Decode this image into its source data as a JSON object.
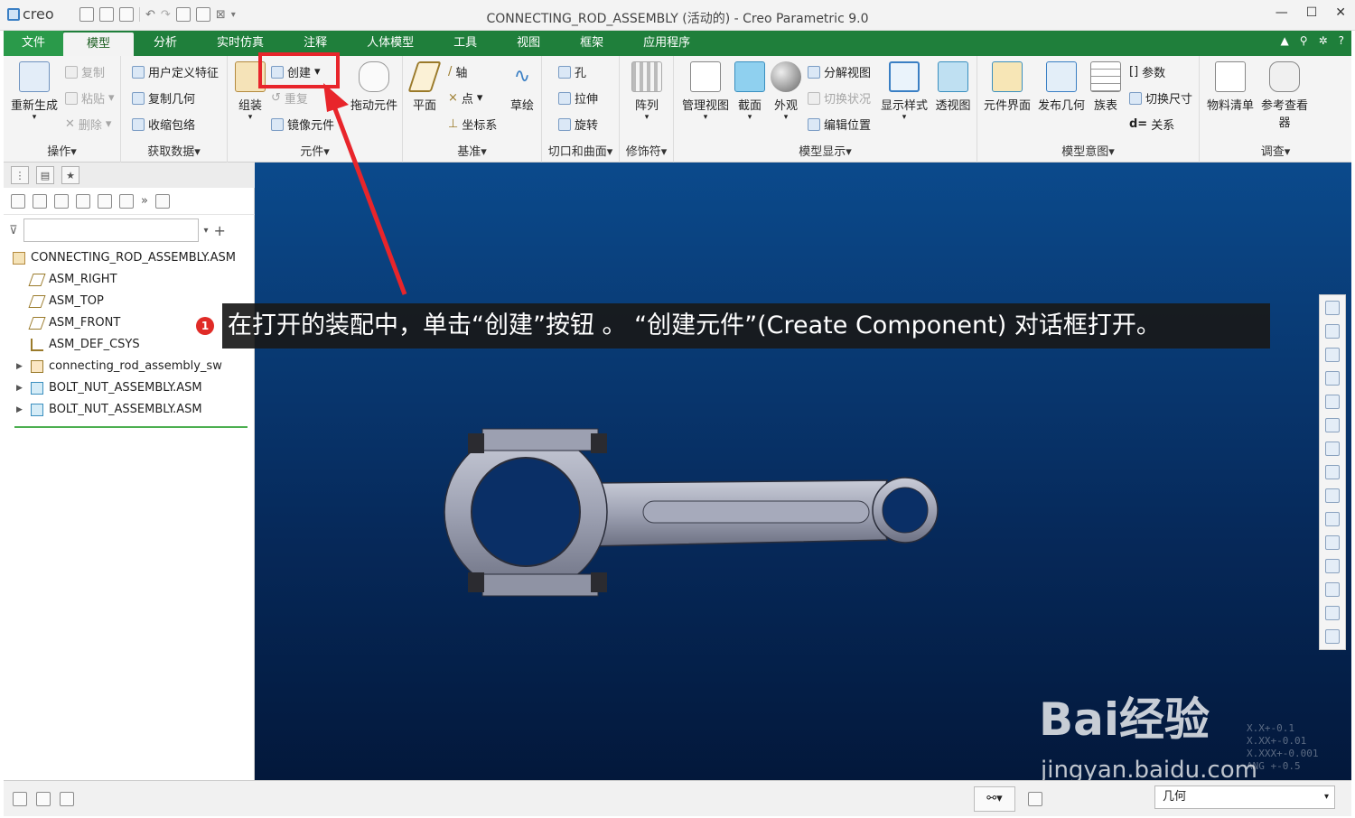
{
  "app": {
    "logo_text": "creo",
    "window_title": "CONNECTING_ROD_ASSEMBLY (活动的) - Creo Parametric 9.0"
  },
  "colors": {
    "menubar": "#1f7f3b",
    "highlight": "#e8252b",
    "viewport_top": "#0b4a8c",
    "viewport_bottom": "#03183b"
  },
  "menu": {
    "items": [
      "文件",
      "模型",
      "分析",
      "实时仿真",
      "注释",
      "人体模型",
      "工具",
      "视图",
      "框架",
      "应用程序"
    ],
    "active": "模型"
  },
  "ribbon": {
    "ops": {
      "regenerate": "重新生成",
      "copy": "复制",
      "paste": "粘贴",
      "delete": "删除",
      "label": "操作"
    },
    "getdata": {
      "udf": "用户定义特征",
      "copy_geom": "复制几何",
      "shrinkwrap": "收缩包络",
      "label": "获取数据"
    },
    "component": {
      "assemble": "组装",
      "create": "创建",
      "repeat": "重复",
      "mirror": "镜像元件",
      "drag": "拖动元件",
      "label": "元件"
    },
    "datum": {
      "plane": "平面",
      "axis": "轴",
      "point": "点",
      "csys": "坐标系",
      "sketch": "草绘",
      "label": "基准"
    },
    "cut": {
      "hole": "孔",
      "extrude": "拉伸",
      "revolve": "旋转",
      "label": "切口和曲面"
    },
    "modifier": {
      "pattern": "阵列",
      "label": "修饰符"
    },
    "display": {
      "manage_views": "管理视图",
      "section": "截面",
      "appearance": "外观",
      "explode": "分解视图",
      "toggle_status": "切换状况",
      "edit_position": "编辑位置",
      "display_style": "显示样式",
      "perspective": "透视图",
      "label": "模型显示"
    },
    "intent": {
      "interface": "元件界面",
      "publish_geom": "发布几何",
      "family_table": "族表",
      "params": "参数",
      "switch_dims": "切换尺寸",
      "relations": "关系",
      "label": "模型意图"
    },
    "investigate": {
      "bom": "物料清单",
      "ref_viewer": "参考查看器",
      "label": "调查"
    }
  },
  "tree": {
    "items": [
      {
        "label": "CONNECTING_ROD_ASSEMBLY.ASM",
        "icon": "assembly-icon"
      },
      {
        "label": "ASM_RIGHT",
        "icon": "datum-plane-icon"
      },
      {
        "label": "ASM_TOP",
        "icon": "datum-plane-icon"
      },
      {
        "label": "ASM_FRONT",
        "icon": "datum-plane-icon"
      },
      {
        "label": "ASM_DEF_CSYS",
        "icon": "csys-icon"
      },
      {
        "label": "connecting_rod_assembly_sw",
        "icon": "part-icon"
      },
      {
        "label": "BOLT_NUT_ASSEMBLY.ASM",
        "icon": "assembly-icon"
      },
      {
        "label": "BOLT_NUT_ASSEMBLY.ASM",
        "icon": "assembly-icon"
      }
    ]
  },
  "callout": {
    "badge": "1",
    "text": "在打开的装配中，单击“创建”按钮 。 “创建元件”(Create Component) 对话框打开。"
  },
  "status": {
    "filter_value": "几何"
  },
  "watermark": {
    "brand": "Bai经验",
    "url": "jingyan.baidu.com",
    "tolerance": "X.X+-0.1\nX.XX+-0.01\nX.XXX+-0.001\nANG +-0.5"
  }
}
